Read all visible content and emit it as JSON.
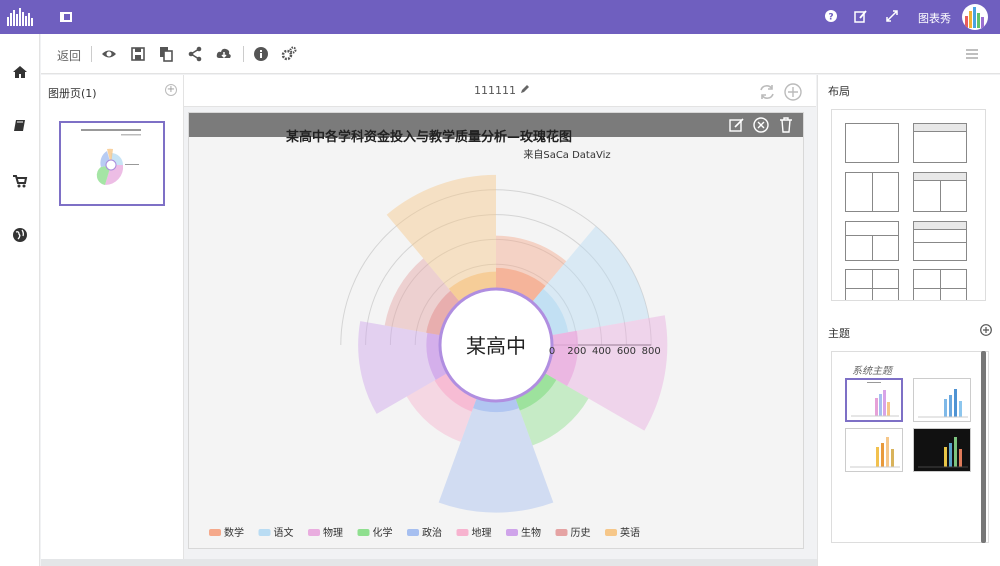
{
  "app": {
    "user_name": "图表秀"
  },
  "toolbar": {
    "back_label": "返回"
  },
  "pages_panel": {
    "title": "图册页(1)",
    "add_symbol": "+"
  },
  "page": {
    "name": "111111"
  },
  "right_panel": {
    "layout_title": "布局",
    "theme_title": "主题",
    "theme_group_label": "系统主题"
  },
  "icons": [
    "home-icon",
    "book-icon",
    "cart-icon",
    "globe-icon",
    "eye-icon",
    "save-icon",
    "copy-icon",
    "share-icon",
    "cloud-download-icon",
    "info-icon",
    "settings-icon",
    "question-icon",
    "edit-icon",
    "fullscreen-icon",
    "refresh-icon",
    "plus-circle-icon",
    "close-circle-icon",
    "trash-icon",
    "pencil-icon",
    "list-icon"
  ],
  "colors": {
    "topbar": "#6f5fbf",
    "accent": "#7e70c6"
  },
  "chart_data": {
    "type": "rose",
    "title": "某高中各学科资金投入与教学质量分析—玫瑰花图",
    "subtitle": "来自SaCa DataViz",
    "center_label": "某高中",
    "radial_ticks": [
      "0",
      "200",
      "400",
      "600",
      "800"
    ],
    "legend": [
      {
        "name": "数学",
        "color": "#f5a98b"
      },
      {
        "name": "语文",
        "color": "#b9dcf3"
      },
      {
        "name": "物理",
        "color": "#e9addf"
      },
      {
        "name": "化学",
        "color": "#8fdf8f"
      },
      {
        "name": "政治",
        "color": "#a6bff0"
      },
      {
        "name": "地理",
        "color": "#f7b3cf"
      },
      {
        "name": "生物",
        "color": "#cfa4ea"
      },
      {
        "name": "历史",
        "color": "#e5a3a3"
      },
      {
        "name": "英语",
        "color": "#f6c789"
      }
    ],
    "outer_ring": [
      {
        "name": "数学",
        "value": 430
      },
      {
        "name": "语文",
        "value": 800
      },
      {
        "name": "物理",
        "value": 930
      },
      {
        "name": "化学",
        "value": 410
      },
      {
        "name": "政治",
        "value": 900
      },
      {
        "name": "地理",
        "value": 380
      },
      {
        "name": "生物",
        "value": 660
      },
      {
        "name": "历史",
        "value": 460
      },
      {
        "name": "英语",
        "value": 920
      }
    ],
    "inner_ring": [
      {
        "name": "数学",
        "value": 170
      },
      {
        "name": "语文",
        "value": 140
      },
      {
        "name": "物理",
        "value": 210
      },
      {
        "name": "化学",
        "value": 110
      },
      {
        "name": "政治",
        "value": 90
      },
      {
        "name": "地理",
        "value": 120
      },
      {
        "name": "生物",
        "value": 110
      },
      {
        "name": "历史",
        "value": 120
      },
      {
        "name": "英语",
        "value": 140
      }
    ]
  }
}
